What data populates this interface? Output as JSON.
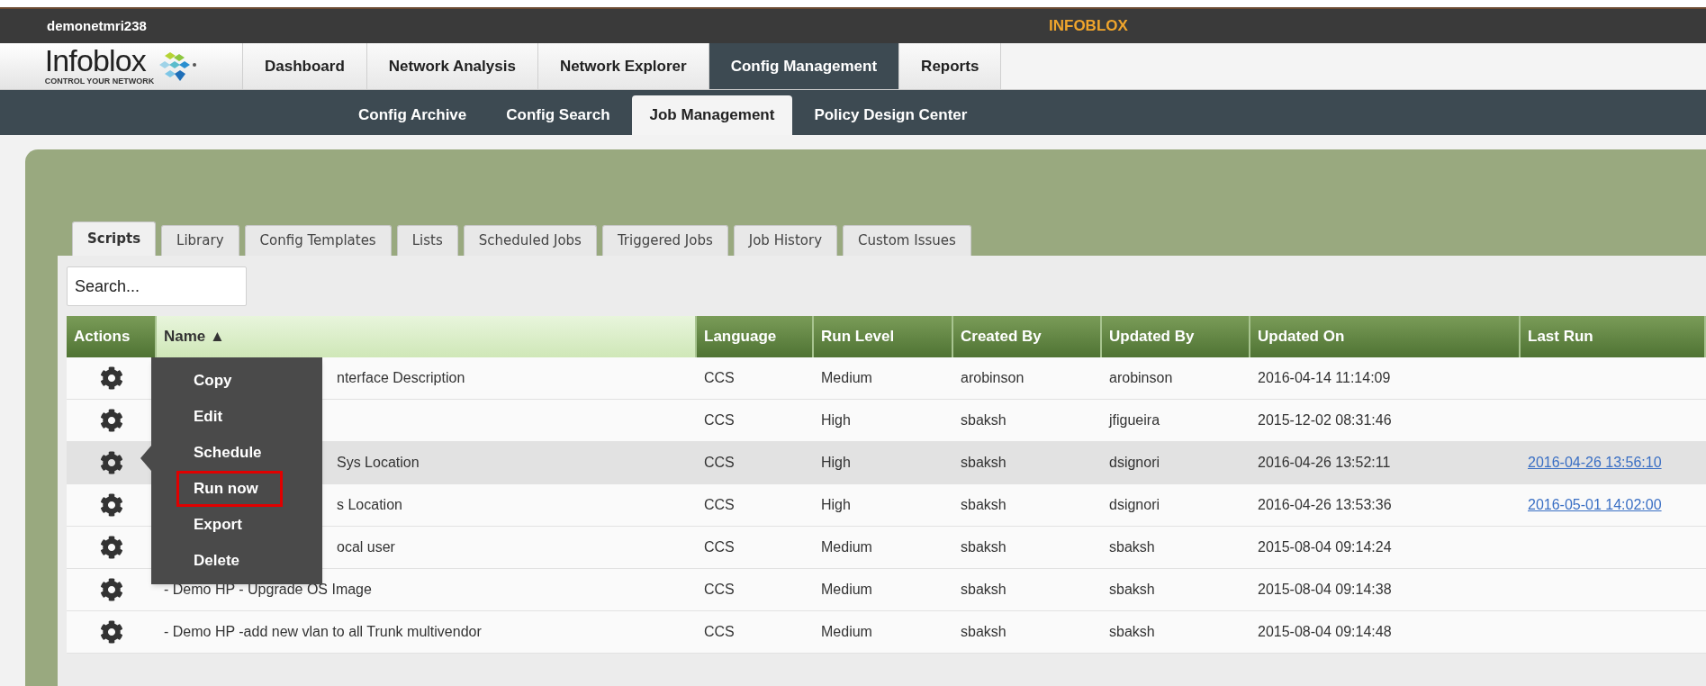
{
  "top_bar": {
    "hostname": "demonetmri238",
    "title": "INFOBLOX"
  },
  "logo": {
    "wordmark": "Infoblox",
    "tagline": "CONTROL YOUR NETWORK"
  },
  "main_nav": [
    {
      "label": "Dashboard",
      "selected": false
    },
    {
      "label": "Network Analysis",
      "selected": false
    },
    {
      "label": "Network Explorer",
      "selected": false
    },
    {
      "label": "Config Management",
      "selected": true
    },
    {
      "label": "Reports",
      "selected": false
    }
  ],
  "sub_nav": [
    {
      "label": "Config Archive",
      "selected": false
    },
    {
      "label": "Config Search",
      "selected": false
    },
    {
      "label": "Job Management",
      "selected": true
    },
    {
      "label": "Policy Design Center",
      "selected": false
    }
  ],
  "tabs": [
    {
      "label": "Scripts",
      "selected": true
    },
    {
      "label": "Library",
      "selected": false
    },
    {
      "label": "Config Templates",
      "selected": false
    },
    {
      "label": "Lists",
      "selected": false
    },
    {
      "label": "Scheduled Jobs",
      "selected": false
    },
    {
      "label": "Triggered Jobs",
      "selected": false
    },
    {
      "label": "Job History",
      "selected": false
    },
    {
      "label": "Custom Issues",
      "selected": false
    }
  ],
  "search": {
    "placeholder": "Search..."
  },
  "table": {
    "columns": [
      "Actions",
      "Name ▲",
      "Language",
      "Run Level",
      "Created By",
      "Updated By",
      "Updated On",
      "Last Run"
    ],
    "rows": [
      {
        "name": "nterface Description",
        "name_covered": true,
        "language": "CCS",
        "run_level": "Medium",
        "created_by": "arobinson",
        "updated_by": "arobinson",
        "updated_on": "2016-04-14 11:14:09",
        "selected": false
      },
      {
        "language": "CCS",
        "run_level": "High",
        "created_by": "sbaksh",
        "updated_by": "jfigueira",
        "updated_on": "2015-12-02 08:31:46",
        "selected": false
      },
      {
        "name": "Sys Location",
        "name_covered": true,
        "language": "CCS",
        "run_level": "High",
        "created_by": "sbaksh",
        "updated_by": "dsignori",
        "updated_on": "2016-04-26 13:52:11",
        "last_run": "2016-04-26 13:56:10",
        "selected": true
      },
      {
        "name": "s Location",
        "name_covered": true,
        "language": "CCS",
        "run_level": "High",
        "created_by": "sbaksh",
        "updated_by": "dsignori",
        "updated_on": "2016-04-26 13:53:36",
        "last_run": "2016-05-01 14:02:00",
        "selected": false
      },
      {
        "name": "ocal user",
        "name_covered": true,
        "language": "CCS",
        "run_level": "Medium",
        "created_by": "sbaksh",
        "updated_by": "sbaksh",
        "updated_on": "2015-08-04 09:14:24",
        "selected": false
      },
      {
        "name": "- Demo HP - Upgrade OS Image",
        "name_covered": false,
        "language": "CCS",
        "run_level": "Medium",
        "created_by": "sbaksh",
        "updated_by": "sbaksh",
        "updated_on": "2015-08-04 09:14:38",
        "selected": false
      },
      {
        "name": "- Demo HP -add new vlan to all Trunk multivendor",
        "name_covered": false,
        "language": "CCS",
        "run_level": "Medium",
        "created_by": "sbaksh",
        "updated_by": "sbaksh",
        "updated_on": "2015-08-04 09:14:48",
        "selected": false
      }
    ]
  },
  "context_menu": {
    "items": [
      {
        "label": "Copy",
        "highlighted": false
      },
      {
        "label": "Edit",
        "highlighted": false
      },
      {
        "label": "Schedule",
        "highlighted": false
      },
      {
        "label": "Run now",
        "highlighted": true
      },
      {
        "label": "Export",
        "highlighted": false
      },
      {
        "label": "Delete",
        "highlighted": false
      }
    ]
  }
}
